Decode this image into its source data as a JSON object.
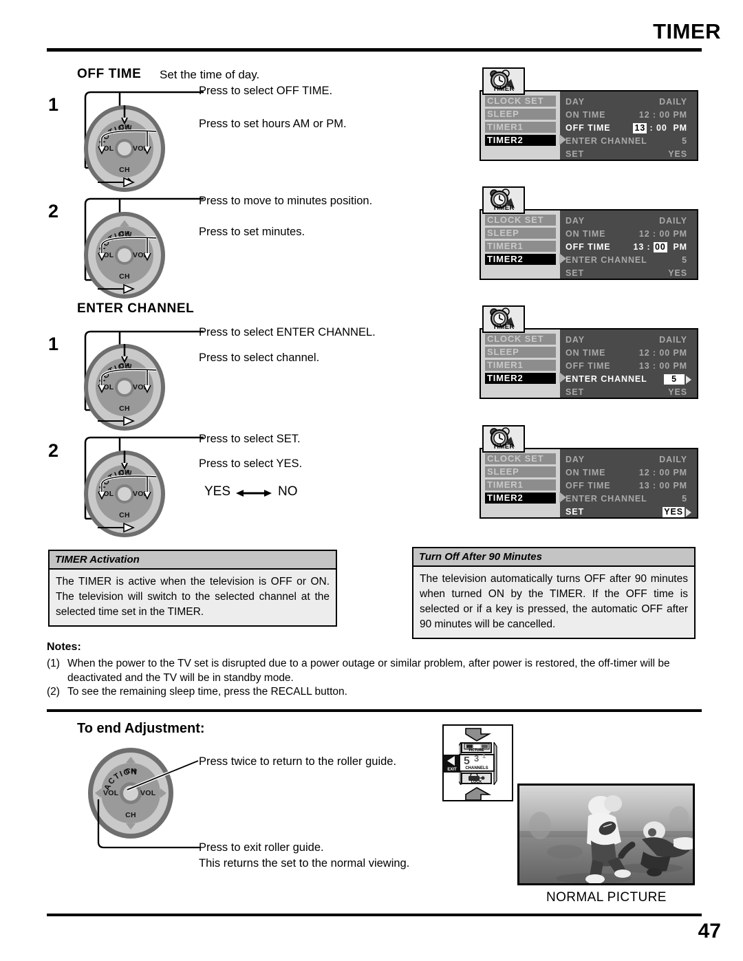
{
  "header": {
    "title": "TIMER",
    "page_number": "47"
  },
  "sections": {
    "off_time": {
      "heading": "OFF TIME",
      "subtitle": "Set the time of day.",
      "steps": [
        {
          "number": "1",
          "callouts": [
            "Press to select OFF TIME.",
            "Press to set hours AM or PM."
          ]
        },
        {
          "number": "2",
          "callouts": [
            "Press to move to minutes position.",
            "Press to set minutes."
          ]
        }
      ]
    },
    "enter_channel": {
      "heading": "ENTER CHANNEL",
      "steps": [
        {
          "number": "1",
          "callouts": [
            "Press to select ENTER CHANNEL.",
            "Press to select channel."
          ]
        },
        {
          "number": "2",
          "callouts": [
            "Press to select SET.",
            "Press to select YES."
          ]
        }
      ],
      "toggle_text": {
        "left": "YES",
        "right": "NO"
      }
    },
    "to_end_adjustment": {
      "heading": "To end Adjustment:",
      "callouts": [
        "Press twice to return to the roller guide.",
        "Press to exit roller guide.",
        "This returns the set to the normal viewing."
      ]
    }
  },
  "dial": {
    "action_label": "ACTION",
    "ch_label": "CH",
    "vol_label": "VOL"
  },
  "osd_panels": [
    {
      "tab_label": "TIMER",
      "menu_items": [
        "CLOCK SET",
        "SLEEP",
        "TIMER1",
        "TIMER2"
      ],
      "active_menu_index": 3,
      "rows": [
        {
          "label": "DAY",
          "value": "DAILY",
          "highlight": false
        },
        {
          "label": "ON TIME",
          "value": "12 : 00  PM",
          "highlight": false
        },
        {
          "label": "OFF TIME",
          "value": "13 : 00  PM",
          "highlight": true,
          "chip": "13",
          "chip_part": "hour"
        },
        {
          "label": "ENTER CHANNEL",
          "value": "5",
          "highlight": false
        },
        {
          "label": "SET",
          "value": "YES",
          "highlight": false
        }
      ]
    },
    {
      "tab_label": "TIMER",
      "menu_items": [
        "CLOCK SET",
        "SLEEP",
        "TIMER1",
        "TIMER2"
      ],
      "active_menu_index": 3,
      "rows": [
        {
          "label": "DAY",
          "value": "DAILY",
          "highlight": false
        },
        {
          "label": "ON TIME",
          "value": "12 : 00  PM",
          "highlight": false
        },
        {
          "label": "OFF TIME",
          "value": "13 : 00  PM",
          "highlight": true,
          "chip": "00",
          "chip_part": "minute"
        },
        {
          "label": "ENTER CHANNEL",
          "value": "5",
          "highlight": false
        },
        {
          "label": "SET",
          "value": "YES",
          "highlight": false
        }
      ]
    },
    {
      "tab_label": "TIMER",
      "menu_items": [
        "CLOCK SET",
        "SLEEP",
        "TIMER1",
        "TIMER2"
      ],
      "active_menu_index": 3,
      "rows": [
        {
          "label": "DAY",
          "value": "DAILY",
          "highlight": false
        },
        {
          "label": "ON TIME",
          "value": "12 : 00  PM",
          "highlight": false
        },
        {
          "label": "OFF TIME",
          "value": "13 : 00  PM",
          "highlight": false
        },
        {
          "label": "ENTER CHANNEL",
          "value": "5",
          "highlight": true,
          "chip": "5",
          "chip_part": "channel"
        },
        {
          "label": "SET",
          "value": "YES",
          "highlight": false
        }
      ]
    },
    {
      "tab_label": "TIMER",
      "menu_items": [
        "CLOCK SET",
        "SLEEP",
        "TIMER1",
        "TIMER2"
      ],
      "active_menu_index": 3,
      "rows": [
        {
          "label": "DAY",
          "value": "DAILY",
          "highlight": false
        },
        {
          "label": "ON TIME",
          "value": "12 : 00  PM",
          "highlight": false
        },
        {
          "label": "OFF TIME",
          "value": "13 : 00  PM",
          "highlight": false
        },
        {
          "label": "ENTER CHANNEL",
          "value": "5",
          "highlight": false
        },
        {
          "label": "SET",
          "value": "YES",
          "highlight": true,
          "chip": "YES",
          "chip_part": "set"
        }
      ]
    }
  ],
  "info_boxes": [
    {
      "title": "TIMER Activation",
      "body": "The TIMER is active when the television is OFF or ON. The television will switch to the selected channel at the selected time set in the TIMER."
    },
    {
      "title": "Turn Off After 90 Minutes",
      "body": "The television automatically turns OFF after 90 minutes when turned ON by the TIMER. If the OFF time is selected or if a key is pressed, the automatic OFF after 90 minutes will be cancelled."
    }
  ],
  "notes": {
    "heading": "Notes:",
    "items": [
      {
        "marker": "(1)",
        "text": "When the power to the TV set is disrupted due to a power outage or similar problem, after power is restored, the off-timer will be deactivated and the TV will be in standby mode."
      },
      {
        "marker": "(2)",
        "text": "To see the remaining sleep time, press the RECALL button."
      }
    ]
  },
  "roller_guide": {
    "picture_label": "PICTURE",
    "channels_label": "CHANNELS",
    "channels_numbers": {
      "big": "5",
      "mid": "3",
      "small": "1"
    },
    "lock_label": "LOCK",
    "exit_label": "EXIT"
  },
  "tv": {
    "caption": "NORMAL PICTURE"
  }
}
